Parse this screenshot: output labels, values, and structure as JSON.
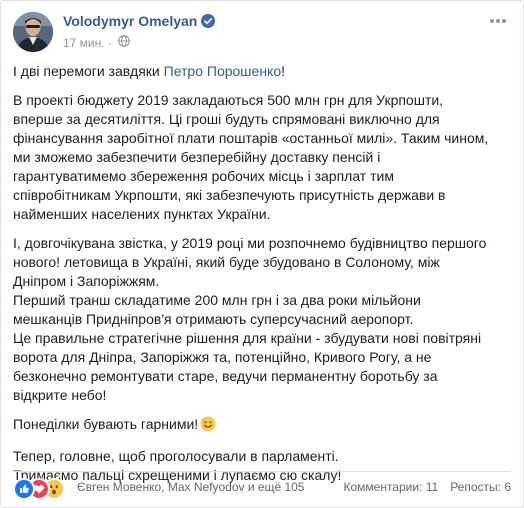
{
  "post": {
    "author": "Volodymyr Omelyan",
    "time": "17 мин.",
    "dot": "·",
    "icons": {
      "verified": "verified-badge-icon",
      "privacy": "globe-icon",
      "menu": "more-options-icon"
    }
  },
  "content": {
    "p1_prefix": "І дві перемоги завдяки ",
    "p1_link": "Петро Порошенко",
    "p1_suffix": "!",
    "p2": "В проекті бюджету 2019 закладаються 500 млн грн для Укрпошти,\nвперше за десятиліття. Ці гроші будуть спрямовані виключно для\nфінансування заробітної плати поштарів «останньої милі». Таким чином,\nми зможемо забезпечити безперебійну доставку пенсій і\nгарантуватимемо збереження робочих місць і зарплат тим\nспівробітникам Укрпошти, які забезпечують присутність держави в\nнайменших населених пунктах України.",
    "p3": "І, довгочікувана звістка, у 2019 році ми розпочнемо будівництво першого\nнового! летовища в Україні, який буде збудовано в Солоному, між\nДніпром і Запоріжжям.\nПерший транш складатиме 200 млн грн і за два роки мільйони\nмешканців Придніпров'я отримають суперсучасний аеропорт.\nЦе правильне стратегічне рішення для країни - збудувати нові повітряні\nворота для Дніпра, Запоріжжя та, потенційно, Кривого Рогу, а не\nбезконечно ремонтувати старе, ведучи перманентну боротьбу за\nвідкрите небо!",
    "p4": "Понеділки бувають гарними!",
    "p5": "Тепер, головне, щоб проголосували в парламенті.\nТримаємо пальці схрещеними і лупаємо сю скалу!",
    "emoji": "smile-emoji-icon"
  },
  "footer": {
    "reactions": [
      "like-reaction-icon",
      "love-reaction-icon",
      "wow-reaction-icon"
    ],
    "people": "Євген Мовенко, Max Nefyodov и ещё 105",
    "comments": "Комментарии: 11",
    "shares": "Репосты: 6"
  }
}
